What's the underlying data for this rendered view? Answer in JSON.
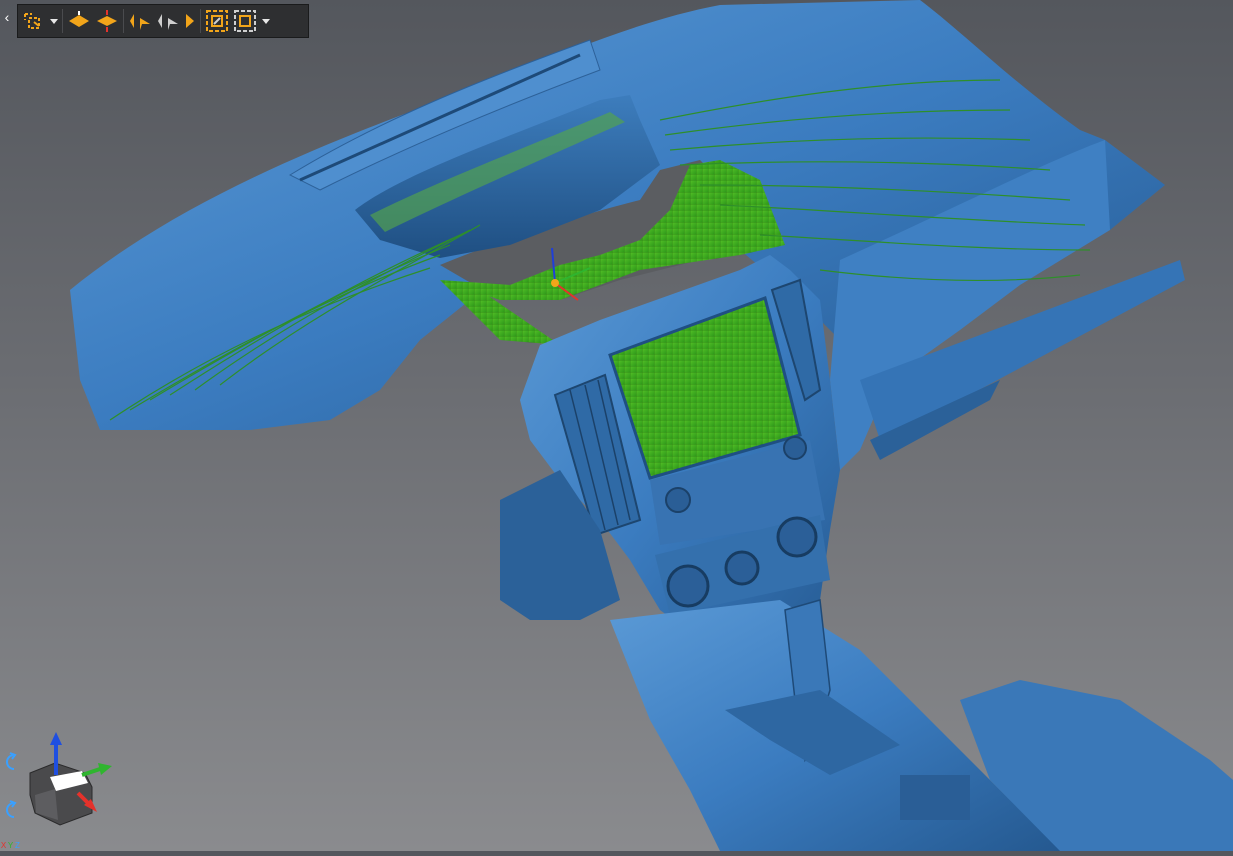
{
  "viewport": {
    "background_top": "#54575d",
    "background_bottom": "#8a8b8e",
    "model_color": "#3a7fc4",
    "highlight_color": "#3cb51e",
    "section_line_color": "#2e8f2a"
  },
  "toolbar": {
    "buttons": [
      {
        "icon": "selection-mode-icon",
        "has_dropdown": true
      },
      {
        "icon": "layer-up-icon"
      },
      {
        "icon": "layer-split-icon"
      },
      {
        "icon": "step-first-icon"
      },
      {
        "icon": "step-previous-icon"
      },
      {
        "icon": "step-next-icon"
      },
      {
        "icon": "fit-to-selection-icon"
      },
      {
        "icon": "fit-all-icon",
        "has_dropdown": true
      }
    ],
    "accent_color": "#f2a51a"
  },
  "axis_widget": {
    "x_color": "#e5322b",
    "y_color": "#2fb52f",
    "z_color": "#1f4fe0",
    "labels": [
      "X",
      "Y",
      "Z"
    ]
  }
}
